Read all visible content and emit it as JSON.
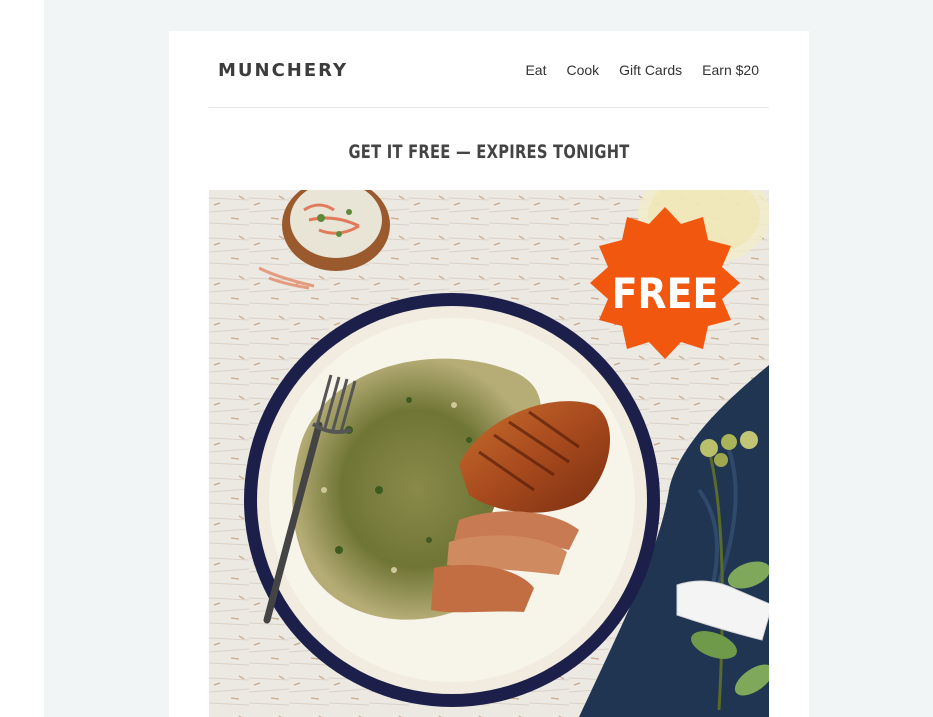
{
  "brand": {
    "logo_text": "MUNCHERY"
  },
  "nav": {
    "items": [
      {
        "label": "Eat"
      },
      {
        "label": "Cook"
      },
      {
        "label": "Gift Cards"
      },
      {
        "label": "Earn $20"
      }
    ]
  },
  "promo": {
    "headline": "GET IT FREE — EXPIRES TONIGHT",
    "badge_text": "FREE",
    "badge_color": "#f2570f"
  },
  "colors": {
    "page_bg": "#f2f5f6",
    "card_bg": "#ffffff",
    "plate_rim": "#1c1f4a"
  }
}
